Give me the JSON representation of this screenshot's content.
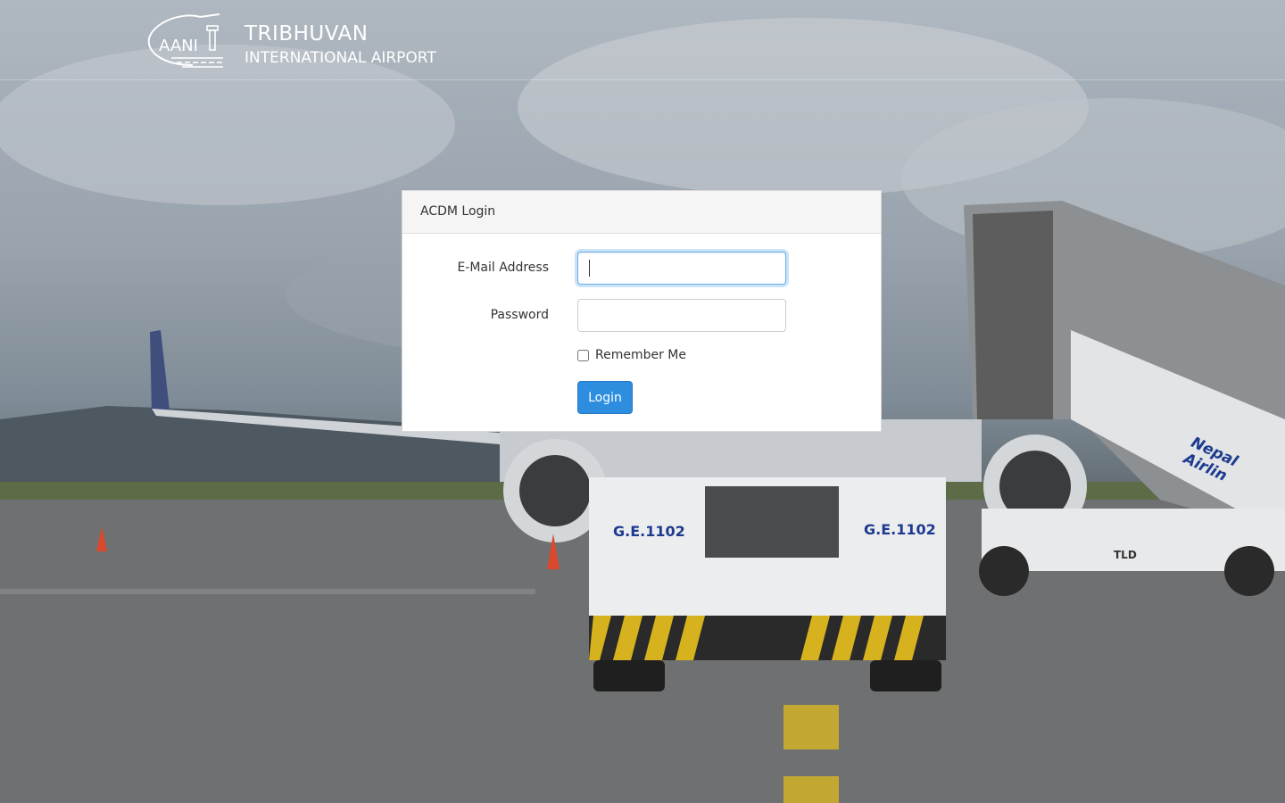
{
  "header": {
    "logo_text": "AANI",
    "title": "TRIBHUVAN",
    "subtitle": "INTERNATIONAL AIRPORT"
  },
  "login_panel": {
    "heading": "ACDM Login",
    "email_label": "E-Mail Address",
    "email_value": "",
    "password_label": "Password",
    "password_value": "",
    "remember_label": "Remember Me",
    "remember_checked": false,
    "login_button": "Login"
  },
  "background": {
    "vehicle_marking": "G.E.1102",
    "stairs_text": "Nepal Airlin",
    "truck_logo": "TLD"
  },
  "colors": {
    "primary_button": "#2d8ee0",
    "focus_border": "#66afe9"
  }
}
